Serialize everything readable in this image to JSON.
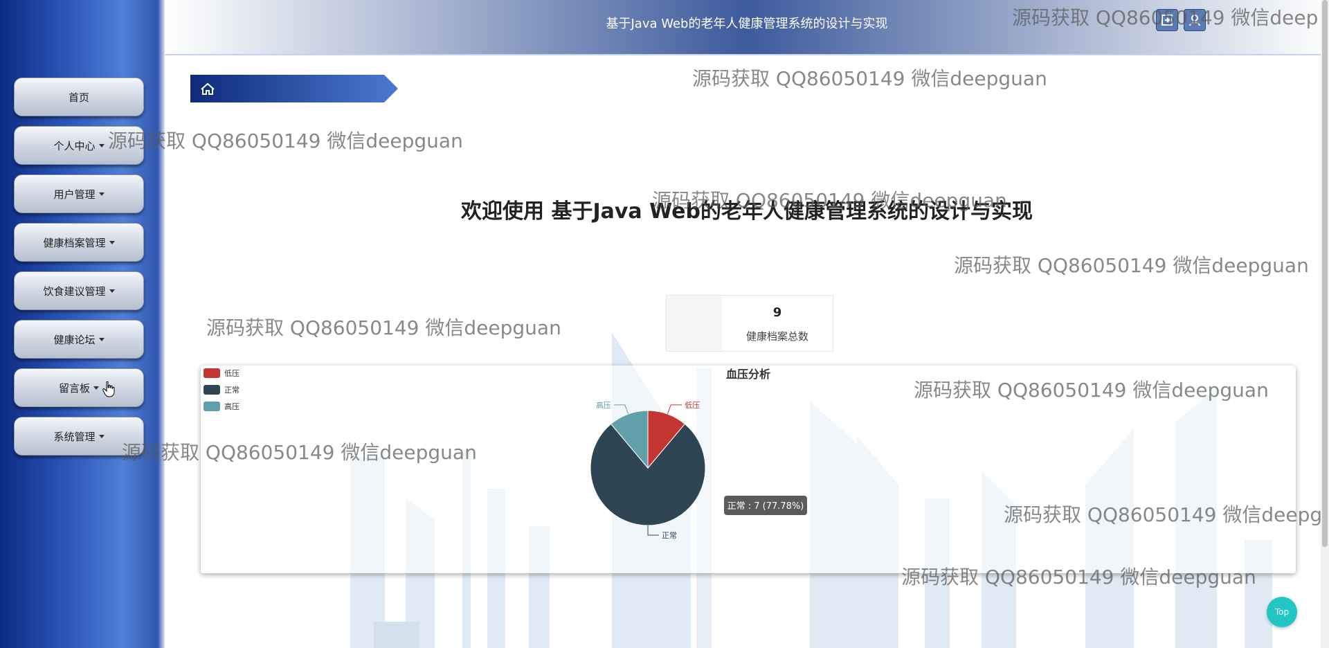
{
  "header": {
    "title": "基于Java Web的老年人健康管理系统的设计与实现",
    "icons": [
      "exit-icon",
      "user-icon"
    ]
  },
  "sidebar": {
    "items": [
      {
        "label": "首页",
        "has_caret": false
      },
      {
        "label": "个人中心",
        "has_caret": true
      },
      {
        "label": "用户管理",
        "has_caret": true
      },
      {
        "label": "健康档案管理",
        "has_caret": true
      },
      {
        "label": "饮食建议管理",
        "has_caret": true
      },
      {
        "label": "健康论坛",
        "has_caret": true
      },
      {
        "label": "留言板",
        "has_caret": true
      },
      {
        "label": "系统管理",
        "has_caret": true
      }
    ]
  },
  "breadcrumb": {
    "icon": "home-icon"
  },
  "main": {
    "welcome": "欢迎使用 基于Java Web的老年人健康管理系统的设计与实现",
    "stat": {
      "value": "9",
      "label": "健康档案总数"
    }
  },
  "chart_data": {
    "type": "pie",
    "title": "血压分析",
    "categories": [
      "低压",
      "正常",
      "高压"
    ],
    "values": [
      1,
      7,
      1
    ],
    "colors": [
      "#c23531",
      "#2f4554",
      "#61a0a8"
    ],
    "legend_position": "top-left",
    "tooltip": "正常 : 7 (77.78%)"
  },
  "watermark": {
    "text": "源码获取 QQ86050149 微信deepguan",
    "text_partial_a": "源码获取 QQ86050149 微信deep",
    "text_partial_b": "源码获取 QQ86050149 微信deepg"
  },
  "top_button": {
    "label": "Top"
  },
  "colors": {
    "sidebar": "#1d46a8",
    "accent": "#22c7c5"
  }
}
